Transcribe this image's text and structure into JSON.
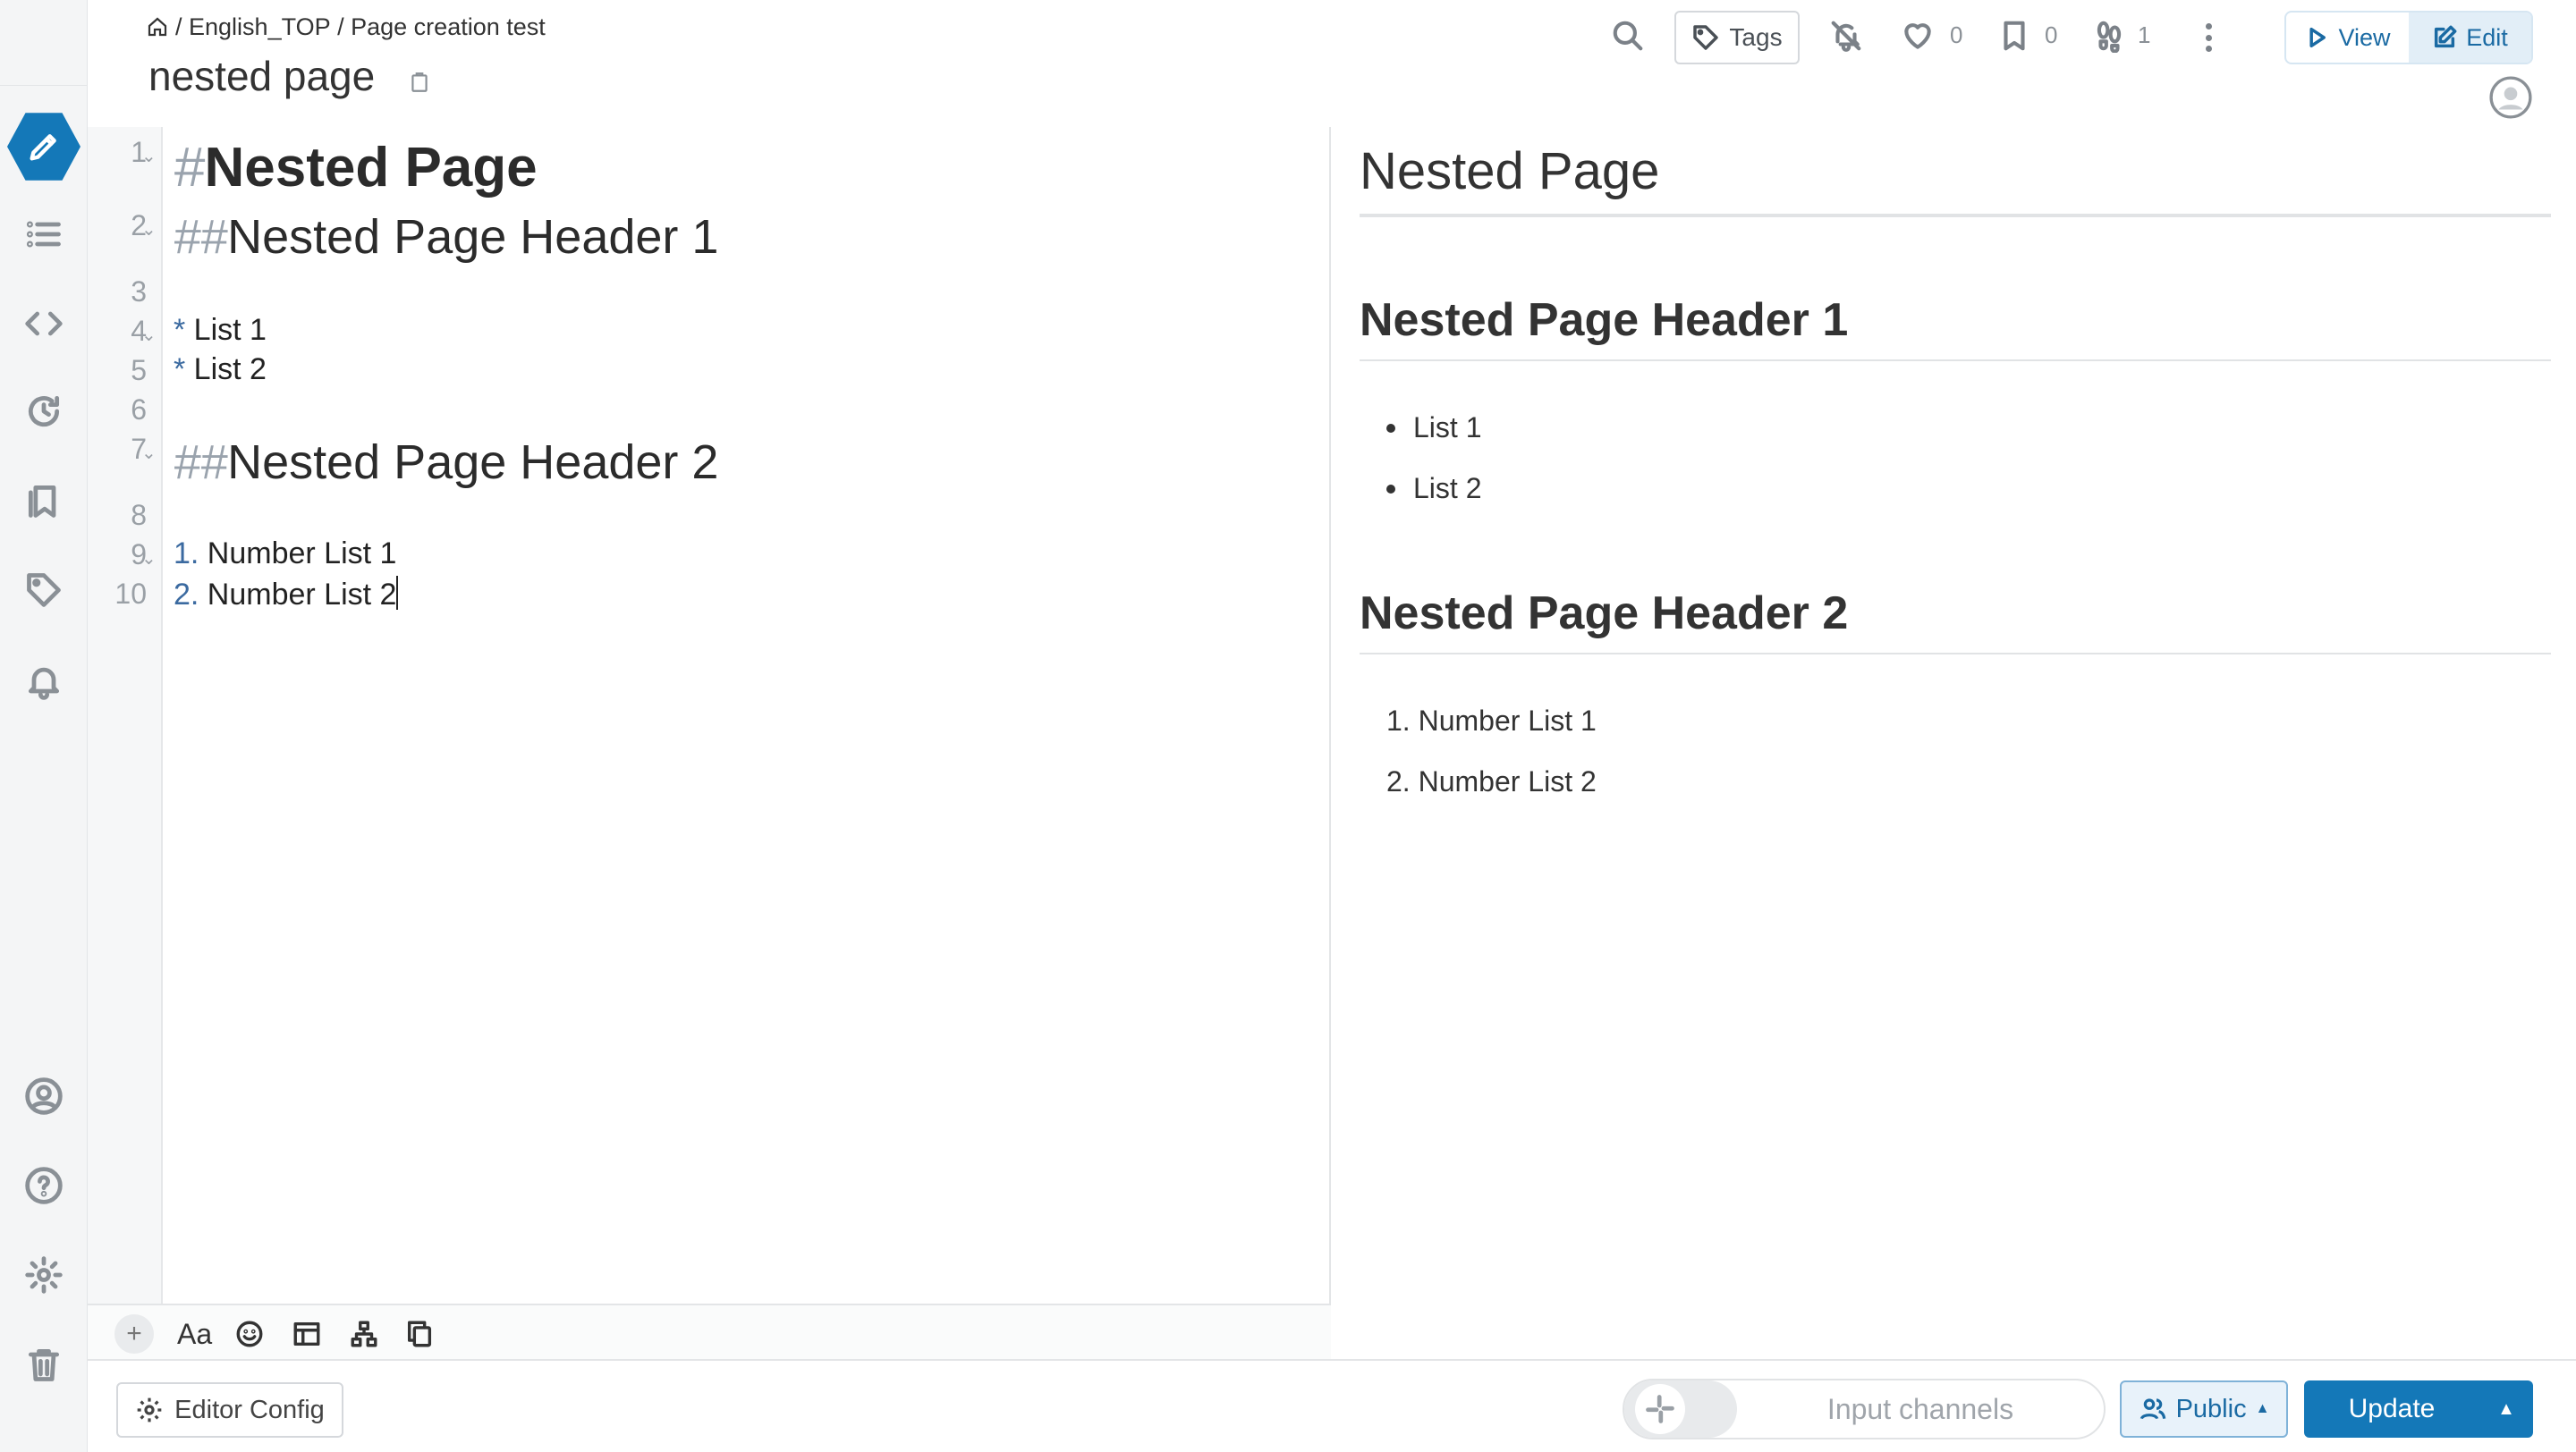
{
  "header": {
    "breadcrumb": [
      "/ ",
      "English_TOP",
      " / ",
      "Page creation test"
    ],
    "page_title": "nested page",
    "tags_label": "Tags",
    "like_count": "0",
    "bookmark_count": "0",
    "seen_count": "1",
    "view_label": "View",
    "edit_label": "Edit"
  },
  "editor": {
    "line_numbers": [
      "1",
      "2",
      "3",
      "4",
      "5",
      "6",
      "7",
      "8",
      "9",
      "10"
    ],
    "lines": {
      "h1_hash": "#",
      "h1_text": "Nested Page",
      "h2a_hash": "##",
      "h2a_text": "Nested Page Header 1",
      "list1_marker": "*",
      "list1_text": " List 1",
      "list2_marker": "*",
      "list2_text": " List 2",
      "h2b_hash": "##",
      "h2b_text": "Nested Page Header 2",
      "num1_marker": "1.",
      "num1_text": " Number List 1",
      "num2_marker": "2.",
      "num2_text": " Number List 2"
    },
    "font_tool_label": "Aa"
  },
  "preview": {
    "h1": "Nested Page",
    "h2a": "Nested Page Header 1",
    "bullets": [
      "List 1",
      "List 2"
    ],
    "h2b": "Nested Page Header 2",
    "numbered": [
      "1. Number List 1",
      "2. Number List 2"
    ]
  },
  "footer": {
    "editor_config_label": "Editor Config",
    "channels_placeholder": "Input channels",
    "public_label": "Public",
    "update_label": "Update"
  },
  "colors": {
    "accent": "#1478b8",
    "sidebar_bg": "#f4f5f6"
  },
  "icons": [
    "home-icon",
    "clipboard-icon",
    "search-icon",
    "tag-icon",
    "bell-off-icon",
    "heart-icon",
    "bookmark-icon",
    "footprints-icon",
    "kebab-icon",
    "play-icon",
    "edit-icon",
    "user-icon",
    "pencil-icon",
    "list-icon",
    "code-icon",
    "history-icon",
    "bookmarks-icon",
    "tag-icon",
    "bell-icon",
    "help-icon",
    "gear-icon",
    "trash-icon",
    "emoji-icon",
    "table-icon",
    "diagram-icon",
    "copy-icon",
    "slack-icon",
    "users-icon"
  ]
}
